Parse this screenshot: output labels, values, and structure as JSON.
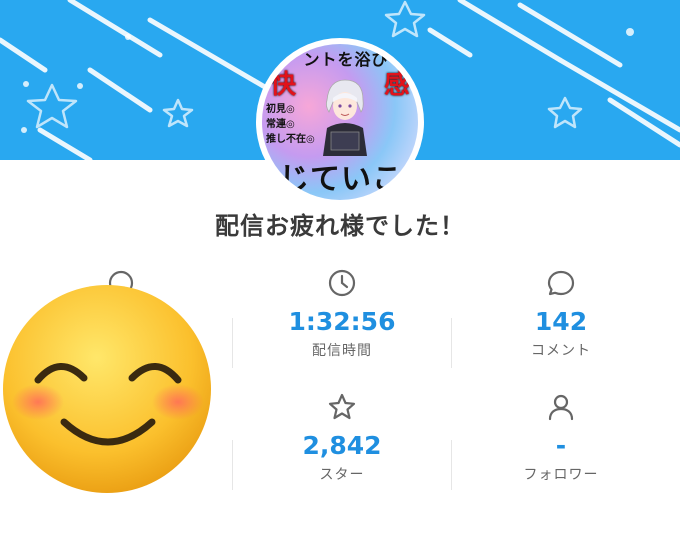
{
  "colors": {
    "banner": "#29a8f0",
    "accent": "#1f8fe0",
    "label": "#666666"
  },
  "avatar": {
    "top_text": "ントを浴び",
    "red_left": "快",
    "red_right": "感",
    "side_lines": [
      "初見◎",
      "常連◎",
      "推し不在◎"
    ],
    "bottom_text": "じていこ"
  },
  "title": "配信お疲れ様でした！",
  "stats": [
    {
      "icon": "clock-icon",
      "value": "1:32:56",
      "label": "配信時間"
    },
    {
      "icon": "comment-icon",
      "value": "142",
      "label": "コメント"
    },
    {
      "icon": "star-icon",
      "value": "2,842",
      "label": "スター"
    },
    {
      "icon": "user-icon",
      "value": "-",
      "label": "フォロワー"
    }
  ],
  "overlay": {
    "icon": "smiling-face-emoji"
  }
}
